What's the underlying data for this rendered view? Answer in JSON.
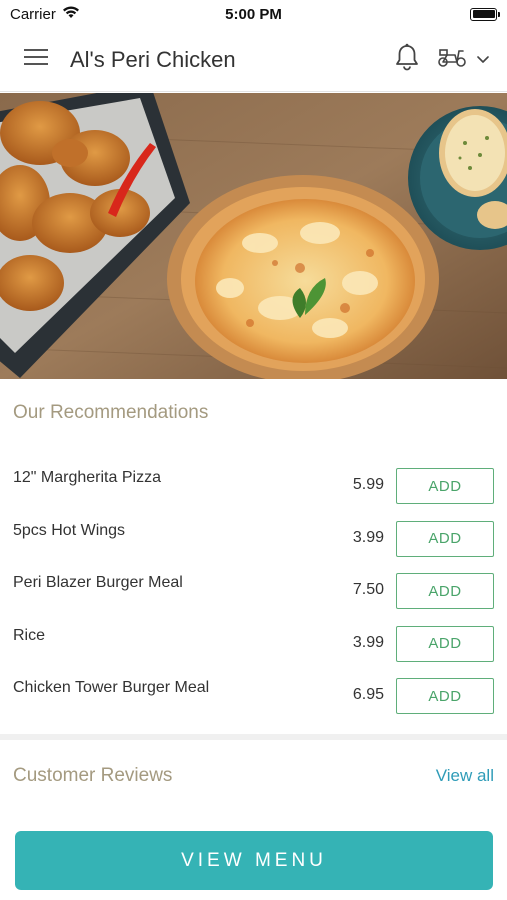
{
  "status_bar": {
    "carrier": "Carrier",
    "time": "5:00 PM"
  },
  "header": {
    "title": "Al's Peri Chicken",
    "icons": [
      "menu-icon",
      "bell-icon",
      "scooter-icon",
      "chevron-down-icon"
    ]
  },
  "recommendations": {
    "title": "Our Recommendations",
    "items": [
      {
        "name": "12\" Margherita Pizza",
        "price": "5.99",
        "button": "ADD"
      },
      {
        "name": "5pcs Hot Wings",
        "price": "3.99",
        "button": "ADD"
      },
      {
        "name": "Peri Blazer Burger Meal",
        "price": "7.50",
        "button": "ADD"
      },
      {
        "name": "Rice",
        "price": "3.99",
        "button": "ADD"
      },
      {
        "name": "Chicken Tower Burger Meal",
        "price": "6.95",
        "button": "ADD"
      }
    ]
  },
  "reviews": {
    "title": "Customer Reviews",
    "view_all": "View all"
  },
  "footer": {
    "view_menu": "VIEW MENU"
  },
  "colors": {
    "accent": "#35b3b5",
    "add_green": "#4aa46a",
    "section_title": "#a49a80",
    "link": "#2f9cb8"
  }
}
